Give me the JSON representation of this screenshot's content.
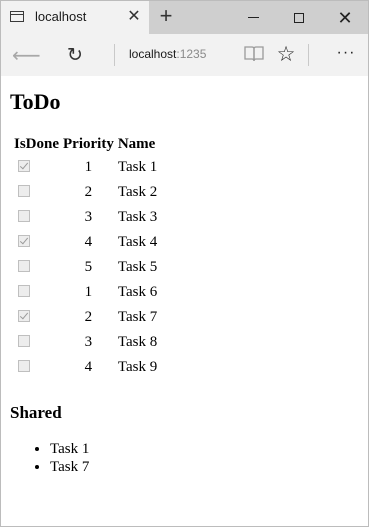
{
  "browser": {
    "tab_title": "localhost",
    "close_tab_glyph": "✕",
    "new_tab_glyph": "+",
    "close_window_glyph": "✕",
    "back_glyph": "⟵",
    "refresh_glyph": "↻",
    "star_glyph": "☆",
    "more_glyph": "···",
    "url_host": "localhost",
    "url_port": ":1235"
  },
  "page": {
    "title": "ToDo",
    "columns": [
      "IsDone",
      "Priority",
      "Name"
    ],
    "tasks": [
      {
        "done": true,
        "priority": "1",
        "name": "Task 1"
      },
      {
        "done": false,
        "priority": "2",
        "name": "Task 2"
      },
      {
        "done": false,
        "priority": "3",
        "name": "Task 3"
      },
      {
        "done": true,
        "priority": "4",
        "name": "Task 4"
      },
      {
        "done": false,
        "priority": "5",
        "name": "Task 5"
      },
      {
        "done": false,
        "priority": "1",
        "name": "Task 6"
      },
      {
        "done": true,
        "priority": "2",
        "name": "Task 7"
      },
      {
        "done": false,
        "priority": "3",
        "name": "Task 8"
      },
      {
        "done": false,
        "priority": "4",
        "name": "Task 9"
      }
    ],
    "shared_heading": "Shared",
    "shared_items": [
      "Task 1",
      "Task 7"
    ]
  }
}
